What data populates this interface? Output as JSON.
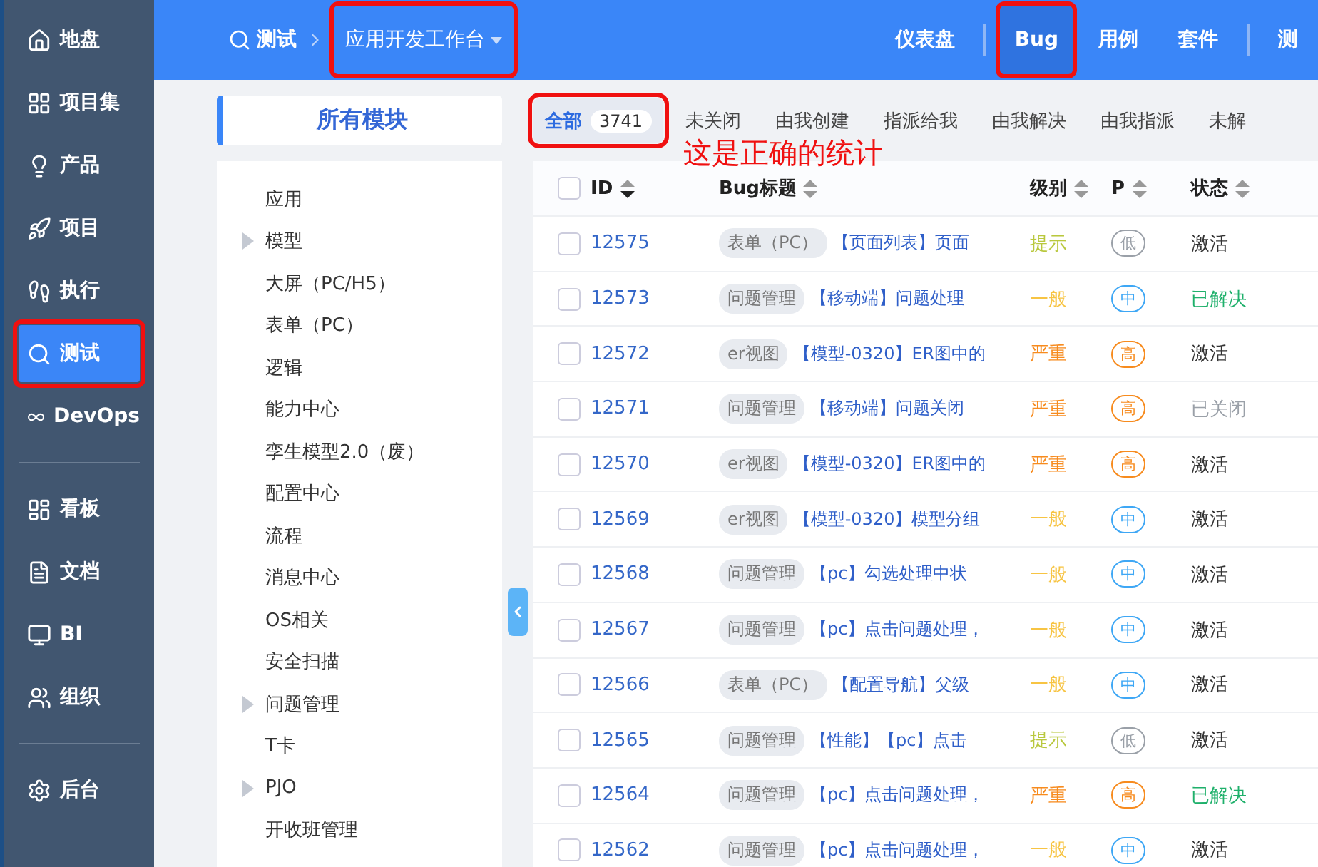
{
  "sidebar": {
    "items": [
      {
        "label": "地盘",
        "selected": false,
        "highlighted": false
      },
      {
        "label": "项目集",
        "selected": false,
        "highlighted": false
      },
      {
        "label": "产品",
        "selected": false,
        "highlighted": false
      },
      {
        "label": "项目",
        "selected": false,
        "highlighted": false
      },
      {
        "label": "执行",
        "selected": false,
        "highlighted": false
      },
      {
        "label": "测试",
        "selected": true,
        "highlighted": true
      },
      {
        "label": "DevOps",
        "selected": false,
        "highlighted": false,
        "divider_after": true
      },
      {
        "label": "看板",
        "selected": false,
        "highlighted": false
      },
      {
        "label": "文档",
        "selected": false,
        "highlighted": false
      },
      {
        "label": "BI",
        "selected": false,
        "highlighted": false
      },
      {
        "label": "组织",
        "selected": false,
        "highlighted": false,
        "divider_after": true
      },
      {
        "label": "后台",
        "selected": false,
        "highlighted": false
      }
    ]
  },
  "breadcrumb": {
    "section": "测试",
    "current": "应用开发工作台",
    "highlighted": true
  },
  "top_nav": [
    {
      "label": "仪表盘",
      "selected": false,
      "highlighted": false,
      "divider_after": true
    },
    {
      "label": "Bug",
      "selected": true,
      "highlighted": true
    },
    {
      "label": "用例",
      "selected": false,
      "highlighted": false
    },
    {
      "label": "套件",
      "selected": false,
      "highlighted": false,
      "divider_after": true
    },
    {
      "label": "测",
      "selected": false,
      "highlighted": false
    }
  ],
  "modules": {
    "title": "所有模块",
    "items": [
      {
        "label": "应用",
        "kind": "leaf"
      },
      {
        "label": "模型",
        "kind": "folder"
      },
      {
        "label": "大屏（PC/H5）",
        "kind": "leaf"
      },
      {
        "label": "表单（PC）",
        "kind": "leaf"
      },
      {
        "label": "逻辑",
        "kind": "leaf"
      },
      {
        "label": "能力中心",
        "kind": "leaf"
      },
      {
        "label": "孪生模型2.0（废）",
        "kind": "leaf"
      },
      {
        "label": "配置中心",
        "kind": "leaf"
      },
      {
        "label": "流程",
        "kind": "leaf"
      },
      {
        "label": "消息中心",
        "kind": "leaf"
      },
      {
        "label": "OS相关",
        "kind": "leaf"
      },
      {
        "label": "安全扫描",
        "kind": "leaf"
      },
      {
        "label": "问题管理",
        "kind": "folder"
      },
      {
        "label": "T卡",
        "kind": "leaf"
      },
      {
        "label": "PJO",
        "kind": "folder"
      },
      {
        "label": "开收班管理",
        "kind": "leaf"
      }
    ]
  },
  "tabs": [
    {
      "label": "全部",
      "count": "3741",
      "selected": true,
      "highlighted": true
    },
    {
      "label": "未关闭",
      "selected": false,
      "highlighted": false
    },
    {
      "label": "由我创建",
      "selected": false,
      "highlighted": false
    },
    {
      "label": "指派给我",
      "selected": false,
      "highlighted": false
    },
    {
      "label": "由我解决",
      "selected": false,
      "highlighted": false
    },
    {
      "label": "由我指派",
      "selected": false,
      "highlighted": false
    },
    {
      "label": "未解",
      "selected": false,
      "highlighted": false
    }
  ],
  "annotation": "这是正确的统计",
  "table": {
    "all_checked": false,
    "columns": [
      {
        "label": "ID",
        "sorted": true
      },
      {
        "label": "Bug标题",
        "sorted": false
      },
      {
        "label": "级别",
        "sorted": false
      },
      {
        "label": "P",
        "sorted": false
      },
      {
        "label": "状态",
        "sorted": false
      }
    ],
    "rows": [
      {
        "id": "12575",
        "checked": false,
        "module": "表单（PC）",
        "title": "【页面列表】页面",
        "severity": {
          "text": "提示",
          "color": "#b9c83e"
        },
        "priority": {
          "text": "低",
          "color": "#9aa0a8"
        },
        "status": {
          "text": "激活",
          "color": "#333333"
        }
      },
      {
        "id": "12573",
        "checked": false,
        "module": "问题管理",
        "title": "【移动端】问题处理",
        "severity": {
          "text": "一般",
          "color": "#f7c443"
        },
        "priority": {
          "text": "中",
          "color": "#3ea7f5"
        },
        "status": {
          "text": "已解决",
          "color": "#1fb06b"
        }
      },
      {
        "id": "12572",
        "checked": false,
        "module": "er视图",
        "title": "【模型-0320】ER图中的",
        "severity": {
          "text": "严重",
          "color": "#f78b1e"
        },
        "priority": {
          "text": "高",
          "color": "#f78b1e"
        },
        "status": {
          "text": "激活",
          "color": "#333333"
        }
      },
      {
        "id": "12571",
        "checked": false,
        "module": "问题管理",
        "title": "【移动端】问题关闭",
        "severity": {
          "text": "严重",
          "color": "#f78b1e"
        },
        "priority": {
          "text": "高",
          "color": "#f78b1e"
        },
        "status": {
          "text": "已关闭",
          "color": "#9aa0a8"
        }
      },
      {
        "id": "12570",
        "checked": false,
        "module": "er视图",
        "title": "【模型-0320】ER图中的",
        "severity": {
          "text": "严重",
          "color": "#f78b1e"
        },
        "priority": {
          "text": "高",
          "color": "#f78b1e"
        },
        "status": {
          "text": "激活",
          "color": "#333333"
        }
      },
      {
        "id": "12569",
        "checked": false,
        "module": "er视图",
        "title": "【模型-0320】模型分组",
        "severity": {
          "text": "一般",
          "color": "#f7c443"
        },
        "priority": {
          "text": "中",
          "color": "#3ea7f5"
        },
        "status": {
          "text": "激活",
          "color": "#333333"
        }
      },
      {
        "id": "12568",
        "checked": false,
        "module": "问题管理",
        "title": "【pc】勾选处理中状",
        "severity": {
          "text": "一般",
          "color": "#f7c443"
        },
        "priority": {
          "text": "中",
          "color": "#3ea7f5"
        },
        "status": {
          "text": "激活",
          "color": "#333333"
        }
      },
      {
        "id": "12567",
        "checked": false,
        "module": "问题管理",
        "title": "【pc】点击问题处理，",
        "severity": {
          "text": "一般",
          "color": "#f7c443"
        },
        "priority": {
          "text": "中",
          "color": "#3ea7f5"
        },
        "status": {
          "text": "激活",
          "color": "#333333"
        }
      },
      {
        "id": "12566",
        "checked": false,
        "module": "表单（PC）",
        "title": "【配置导航】父级",
        "severity": {
          "text": "一般",
          "color": "#f7c443"
        },
        "priority": {
          "text": "中",
          "color": "#3ea7f5"
        },
        "status": {
          "text": "激活",
          "color": "#333333"
        }
      },
      {
        "id": "12565",
        "checked": false,
        "module": "问题管理",
        "title": "【性能】【pc】点击",
        "severity": {
          "text": "提示",
          "color": "#b9c83e"
        },
        "priority": {
          "text": "低",
          "color": "#9aa0a8"
        },
        "status": {
          "text": "激活",
          "color": "#333333"
        }
      },
      {
        "id": "12564",
        "checked": false,
        "module": "问题管理",
        "title": "【pc】点击问题处理，",
        "severity": {
          "text": "严重",
          "color": "#f78b1e"
        },
        "priority": {
          "text": "高",
          "color": "#f78b1e"
        },
        "status": {
          "text": "已解决",
          "color": "#1fb06b"
        }
      },
      {
        "id": "12562",
        "checked": false,
        "module": "问题管理",
        "title": "【pc】点击问题处理，",
        "severity": {
          "text": "一般",
          "color": "#f7c443"
        },
        "priority": {
          "text": "中",
          "color": "#3ea7f5"
        },
        "status": {
          "text": "激活",
          "color": "#333333"
        }
      }
    ]
  }
}
